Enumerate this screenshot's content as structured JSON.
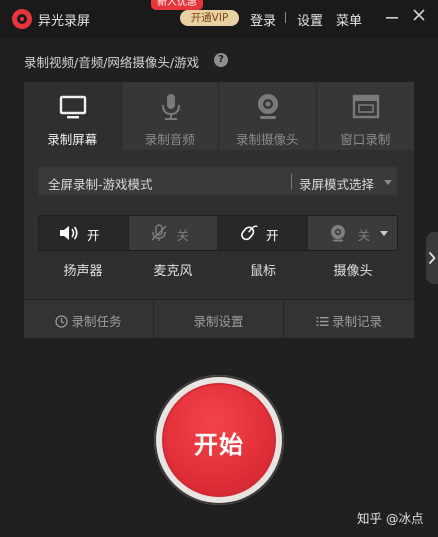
{
  "app": {
    "title": "异光录屏",
    "promo_badge": "新人优惠",
    "vip_button": "开通VIP",
    "nav": [
      "登录",
      "设置",
      "菜单"
    ],
    "window_controls": [
      "minimize-icon",
      "close-icon"
    ]
  },
  "section_title": "录制视频/音频/网络摄像头/游戏",
  "tabs": [
    {
      "label": "录制屏幕",
      "icon": "monitor-icon",
      "active": true
    },
    {
      "label": "录制音频",
      "icon": "microphone-icon",
      "active": false
    },
    {
      "label": "录制摄像头",
      "icon": "webcam-icon",
      "active": false
    },
    {
      "label": "窗口录制",
      "icon": "window-icon",
      "active": false
    }
  ],
  "mode": {
    "current": "全屏录制-游戏模式",
    "select_label": "录屏模式选择"
  },
  "devices": [
    {
      "label": "扬声器",
      "state": "开",
      "on": true,
      "icon": "speaker-icon"
    },
    {
      "label": "麦克风",
      "state": "关",
      "on": false,
      "icon": "microphone-off-icon"
    },
    {
      "label": "鼠标",
      "state": "开",
      "on": true,
      "icon": "mouse-icon"
    },
    {
      "label": "摄像头",
      "state": "关",
      "on": false,
      "icon": "webcam-icon",
      "dropdown": true
    }
  ],
  "actions": [
    {
      "label": "录制任务",
      "icon": "clock-icon"
    },
    {
      "label": "录制设置",
      "icon": ""
    },
    {
      "label": "录制记录",
      "icon": "list-icon"
    }
  ],
  "start_button": "开始",
  "watermark": "知乎 @冰点",
  "colors": {
    "accent_red": "#e8343b",
    "vip_gold": "#e9d1a3",
    "background": "#202020",
    "panel": "#2f2f2f"
  }
}
